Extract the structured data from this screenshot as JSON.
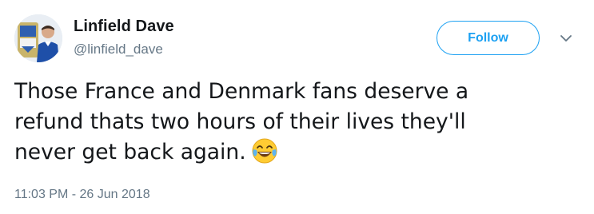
{
  "user": {
    "name": "Linfield Dave",
    "handle": "@linfield_dave"
  },
  "follow_button": {
    "label": "Follow"
  },
  "tweet": {
    "lines": [
      "Those France and Denmark fans deserve a",
      "refund thats two hours of their lives they'll",
      "never get back again."
    ],
    "emoji": "face-with-tears-of-joy"
  },
  "timestamp": "11:03 PM - 26 Jun 2018",
  "colors": {
    "accent": "#1da1f2",
    "text": "#14171a",
    "muted": "#657786"
  }
}
